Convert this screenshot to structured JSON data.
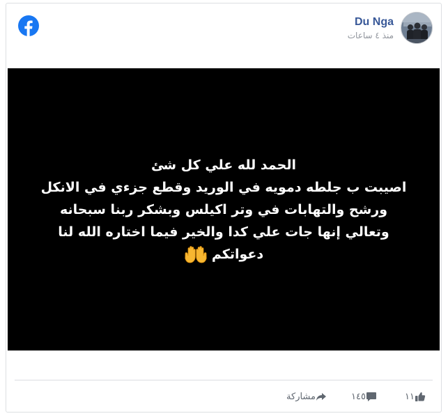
{
  "author": {
    "name": "Du Nga",
    "time": "منذ ٤ ساعات"
  },
  "post": {
    "lines": [
      "الحمد لله علي كل شئ",
      "اصيبت ب جلطه دمويه في الوريد وقطع جزءي في الانكل",
      "ورشح والتهابات في وتر اكيلس وبشكر ربنا سبحانه",
      "وتعالي إنها جات علي كدا والخير فيما اختاره الله لنا",
      "دعواتكم"
    ],
    "emoji": "raised-hands-icon"
  },
  "footer": {
    "likes": "١١",
    "comments": "١٤٥",
    "shares": "مشاركة"
  },
  "colors": {
    "facebook_blue": "#1877f2",
    "name_link": "#385898",
    "meta_gray": "#90949c",
    "image_bg": "#000000"
  }
}
